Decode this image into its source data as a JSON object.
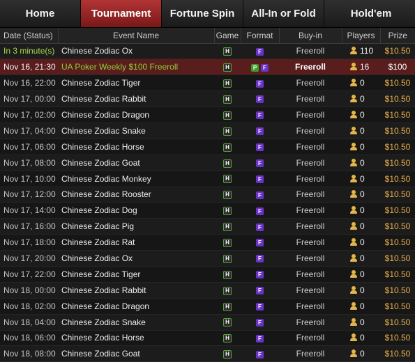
{
  "tabs": [
    {
      "label": "Home"
    },
    {
      "label": "Tournament",
      "active": true
    },
    {
      "label": "Fortune Spin"
    },
    {
      "label": "All-In or Fold"
    },
    {
      "label": "Hold'em"
    }
  ],
  "columns": {
    "date": "Date (Status)",
    "event": "Event Name",
    "game": "Game",
    "format": "Format",
    "buyin": "Buy-in",
    "players": "Players",
    "prize": "Prize"
  },
  "rows": [
    {
      "date": "In 3 minute(s)",
      "event": "Chinese Zodiac Ox",
      "game": "H",
      "formats": [
        "F"
      ],
      "buyin": "Freeroll",
      "players": "110",
      "prize": "$10.50",
      "status": "running"
    },
    {
      "date": "Nov 16, 21:30",
      "event": "UA Poker Weekly $100 Freeroll",
      "game": "H",
      "formats": [
        "P",
        "F"
      ],
      "buyin": "Freeroll",
      "players": "16",
      "prize": "$100",
      "status": "featured"
    },
    {
      "date": "Nov 16, 22:00",
      "event": "Chinese Zodiac Tiger",
      "game": "H",
      "formats": [
        "F"
      ],
      "buyin": "Freeroll",
      "players": "0",
      "prize": "$10.50"
    },
    {
      "date": "Nov 17, 00:00",
      "event": "Chinese Zodiac Rabbit",
      "game": "H",
      "formats": [
        "F"
      ],
      "buyin": "Freeroll",
      "players": "0",
      "prize": "$10.50"
    },
    {
      "date": "Nov 17, 02:00",
      "event": "Chinese Zodiac Dragon",
      "game": "H",
      "formats": [
        "F"
      ],
      "buyin": "Freeroll",
      "players": "0",
      "prize": "$10.50"
    },
    {
      "date": "Nov 17, 04:00",
      "event": "Chinese Zodiac Snake",
      "game": "H",
      "formats": [
        "F"
      ],
      "buyin": "Freeroll",
      "players": "0",
      "prize": "$10.50"
    },
    {
      "date": "Nov 17, 06:00",
      "event": "Chinese Zodiac Horse",
      "game": "H",
      "formats": [
        "F"
      ],
      "buyin": "Freeroll",
      "players": "0",
      "prize": "$10.50"
    },
    {
      "date": "Nov 17, 08:00",
      "event": "Chinese Zodiac Goat",
      "game": "H",
      "formats": [
        "F"
      ],
      "buyin": "Freeroll",
      "players": "0",
      "prize": "$10.50"
    },
    {
      "date": "Nov 17, 10:00",
      "event": "Chinese Zodiac Monkey",
      "game": "H",
      "formats": [
        "F"
      ],
      "buyin": "Freeroll",
      "players": "0",
      "prize": "$10.50"
    },
    {
      "date": "Nov 17, 12:00",
      "event": "Chinese Zodiac Rooster",
      "game": "H",
      "formats": [
        "F"
      ],
      "buyin": "Freeroll",
      "players": "0",
      "prize": "$10.50"
    },
    {
      "date": "Nov 17, 14:00",
      "event": "Chinese Zodiac Dog",
      "game": "H",
      "formats": [
        "F"
      ],
      "buyin": "Freeroll",
      "players": "0",
      "prize": "$10.50"
    },
    {
      "date": "Nov 17, 16:00",
      "event": "Chinese Zodiac Pig",
      "game": "H",
      "formats": [
        "F"
      ],
      "buyin": "Freeroll",
      "players": "0",
      "prize": "$10.50"
    },
    {
      "date": "Nov 17, 18:00",
      "event": "Chinese Zodiac Rat",
      "game": "H",
      "formats": [
        "F"
      ],
      "buyin": "Freeroll",
      "players": "0",
      "prize": "$10.50"
    },
    {
      "date": "Nov 17, 20:00",
      "event": "Chinese Zodiac Ox",
      "game": "H",
      "formats": [
        "F"
      ],
      "buyin": "Freeroll",
      "players": "0",
      "prize": "$10.50"
    },
    {
      "date": "Nov 17, 22:00",
      "event": "Chinese Zodiac Tiger",
      "game": "H",
      "formats": [
        "F"
      ],
      "buyin": "Freeroll",
      "players": "0",
      "prize": "$10.50"
    },
    {
      "date": "Nov 18, 00:00",
      "event": "Chinese Zodiac Rabbit",
      "game": "H",
      "formats": [
        "F"
      ],
      "buyin": "Freeroll",
      "players": "0",
      "prize": "$10.50"
    },
    {
      "date": "Nov 18, 02:00",
      "event": "Chinese Zodiac Dragon",
      "game": "H",
      "formats": [
        "F"
      ],
      "buyin": "Freeroll",
      "players": "0",
      "prize": "$10.50"
    },
    {
      "date": "Nov 18, 04:00",
      "event": "Chinese Zodiac Snake",
      "game": "H",
      "formats": [
        "F"
      ],
      "buyin": "Freeroll",
      "players": "0",
      "prize": "$10.50"
    },
    {
      "date": "Nov 18, 06:00",
      "event": "Chinese Zodiac Horse",
      "game": "H",
      "formats": [
        "F"
      ],
      "buyin": "Freeroll",
      "players": "0",
      "prize": "$10.50"
    },
    {
      "date": "Nov 18, 08:00",
      "event": "Chinese Zodiac Goat",
      "game": "H",
      "formats": [
        "F"
      ],
      "buyin": "Freeroll",
      "players": "0",
      "prize": "$10.50"
    }
  ],
  "colors": {
    "active_tab": "#9c2626",
    "featured_row": "#5a1d1d",
    "prize": "#e9b04b",
    "live_status": "#a8d94e",
    "format_badge": "#6a33c7",
    "player_icon": "#e3b64a"
  },
  "icons": {
    "game_badge": "holdem-badge-icon",
    "format_badge": "freeroll-format-icon",
    "players": "user-icon"
  }
}
